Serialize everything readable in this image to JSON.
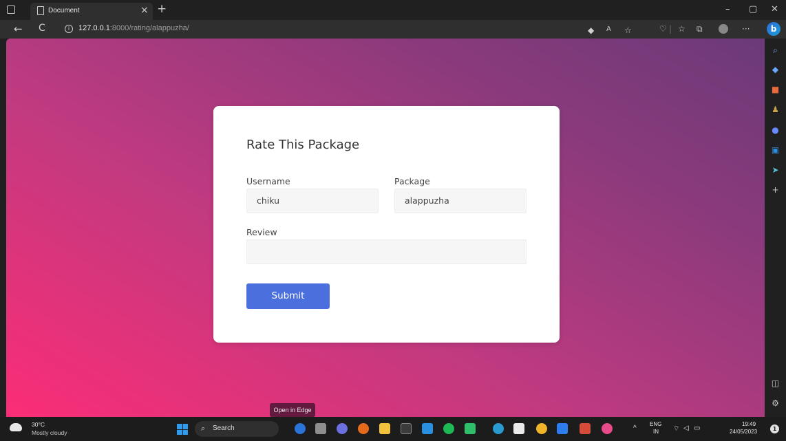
{
  "browser": {
    "tab_title": "Document",
    "tab_close": "×",
    "new_tab": "+",
    "url_host": "127.0.0.1",
    "url_rest": ":8000/rating/alappuzha/",
    "back": "←",
    "refresh": "C",
    "more": "···",
    "bing": "b"
  },
  "window_controls": {
    "minimize": "–",
    "maximize": "▢",
    "close": "✕"
  },
  "form": {
    "title": "Rate This Package",
    "username_label": "Username",
    "username_value": "chiku",
    "package_label": "Package",
    "package_value": "alappuzha",
    "review_label": "Review",
    "review_value": "",
    "submit_label": "Submit"
  },
  "tooltip": "Open in Edge",
  "taskbar": {
    "weather_temp": "30°C",
    "weather_desc": "Mostly cloudy",
    "search_label": "Search",
    "lang_top": "ENG",
    "lang_bottom": "IN",
    "time": "19:49",
    "date": "24/05/2023",
    "notification_count": "1"
  },
  "colors": {
    "gradient_start": "#fb2d76",
    "gradient_end": "#6b3a78",
    "submit": "#4b6fdc",
    "card": "#ffffff"
  },
  "icons": [
    "search-icon",
    "tag-icon",
    "briefcase-icon",
    "people-icon",
    "copilot-icon",
    "outlook-icon",
    "send-icon",
    "add-icon",
    "split-screen-icon",
    "settings-icon"
  ]
}
